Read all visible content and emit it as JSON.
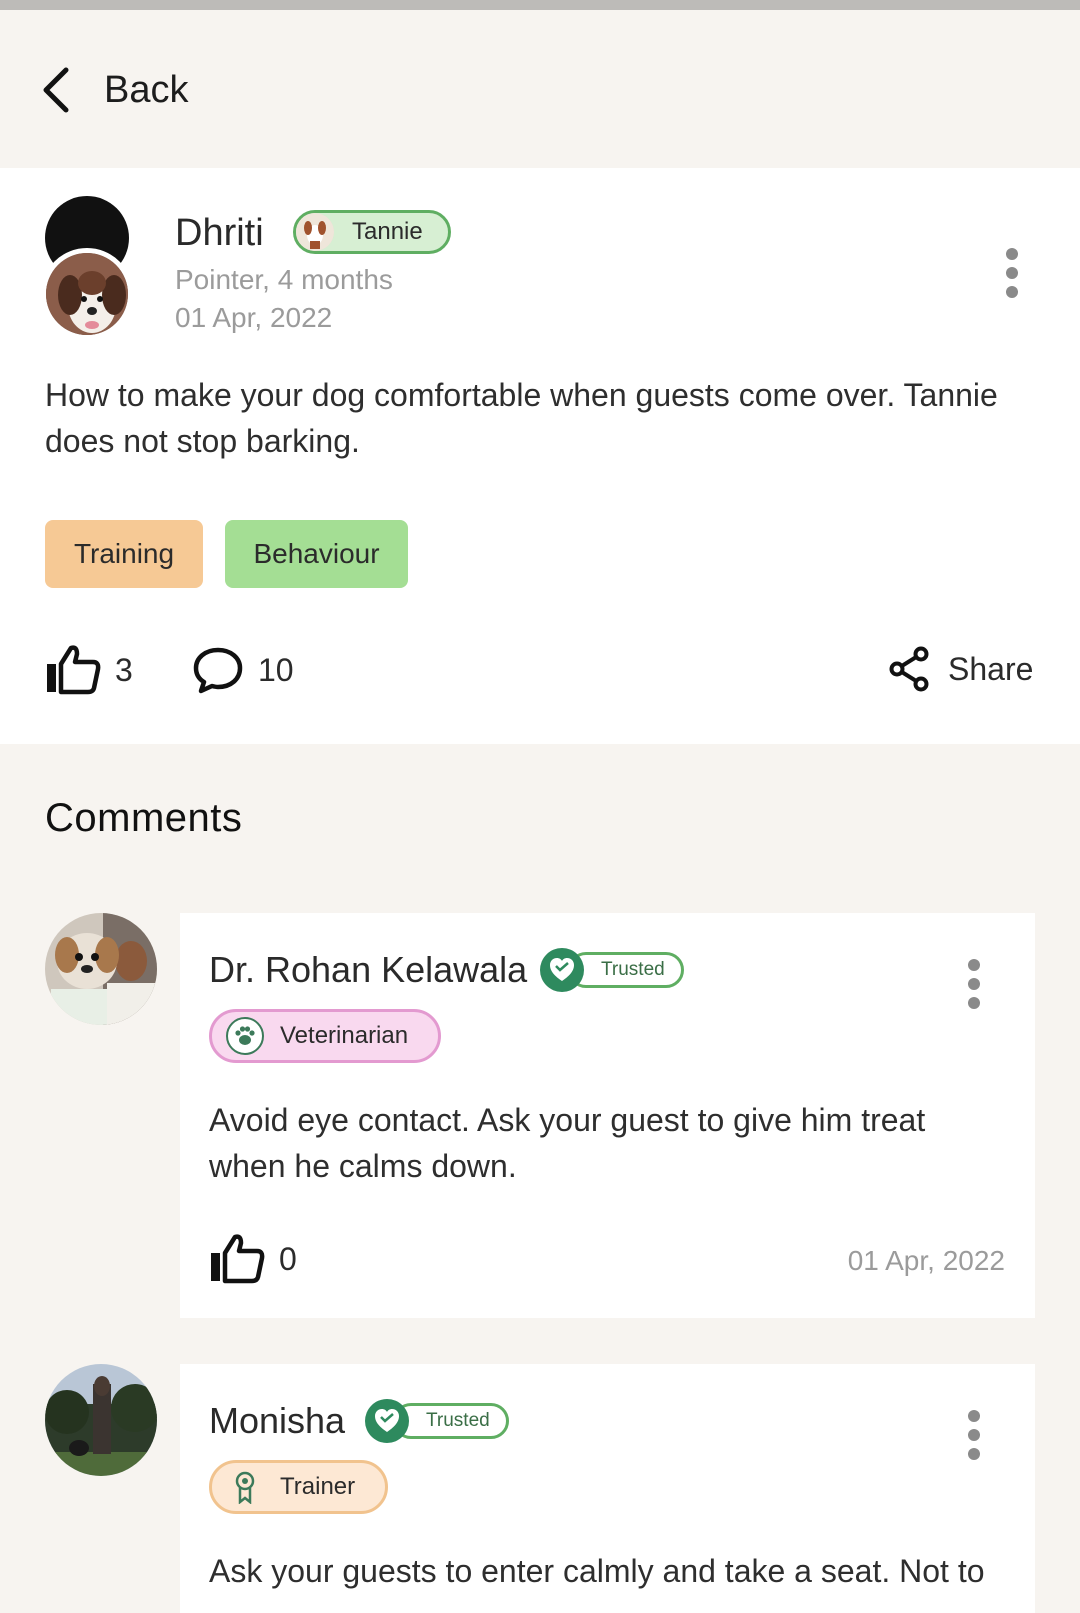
{
  "header": {
    "back_label": "Back"
  },
  "post": {
    "author": "Dhriti",
    "pet_tag": "Tannie",
    "pet_info": "Pointer, 4 months",
    "date": "01 Apr, 2022",
    "text": "How to make your dog comfortable when guests come over. Tannie does not stop barking.",
    "tags": [
      "Training",
      "Behaviour"
    ],
    "likes": "3",
    "comments": "10",
    "share_label": "Share"
  },
  "comments_section": {
    "title": "Comments",
    "items": [
      {
        "name": "Dr. Rohan Kelawala",
        "badge": "Trusted",
        "role": "Veterinarian",
        "text": "Avoid eye contact. Ask your guest to give him treat when he calms down.",
        "likes": "0",
        "date": "01 Apr, 2022"
      },
      {
        "name": "Monisha",
        "badge": "Trusted",
        "role": "Trainer",
        "text": "Ask your guests to enter calmly and take a seat. Not to"
      }
    ]
  },
  "colors": {
    "background": "#f7f4f0",
    "training_chip": "#f6c995",
    "behaviour_chip": "#a4de94",
    "trusted_green": "#2e8a5e",
    "pet_tag_border": "#5fae62"
  },
  "icons": [
    "chevron-left-icon",
    "more-vertical-icon",
    "thumbs-up-icon",
    "comment-bubble-icon",
    "share-icon",
    "paw-icon",
    "ribbon-icon",
    "trusted-seal-icon"
  ]
}
